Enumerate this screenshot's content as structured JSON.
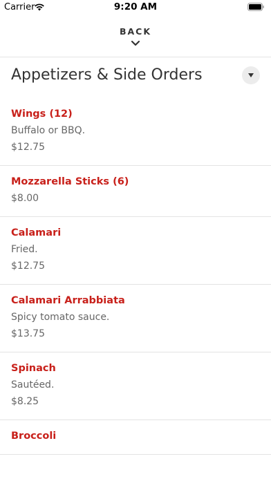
{
  "status_bar": {
    "carrier": "Carrier",
    "time": "9:20 AM"
  },
  "nav": {
    "back_label": "BACK"
  },
  "section": {
    "title": "Appetizers & Side Orders"
  },
  "items": [
    {
      "name": "Wings (12)",
      "description": "Buffalo or BBQ.",
      "price": "$12.75"
    },
    {
      "name": "Mozzarella Sticks (6)",
      "description": "",
      "price": "$8.00"
    },
    {
      "name": "Calamari",
      "description": "Fried.",
      "price": "$12.75"
    },
    {
      "name": "Calamari Arrabbiata",
      "description": "Spicy tomato sauce.",
      "price": "$13.75"
    },
    {
      "name": "Spinach",
      "description": "Sautéed.",
      "price": "$8.25"
    },
    {
      "name": "Broccoli",
      "description": "",
      "price": ""
    }
  ],
  "colors": {
    "accent": "#c8201a",
    "text": "#333333",
    "muted": "#666666",
    "divider": "#e3e3e3"
  },
  "icons": {
    "wifi": "wifi-icon",
    "battery": "battery-icon",
    "back": "chevron-down-icon",
    "dropdown": "caret-down-icon"
  }
}
